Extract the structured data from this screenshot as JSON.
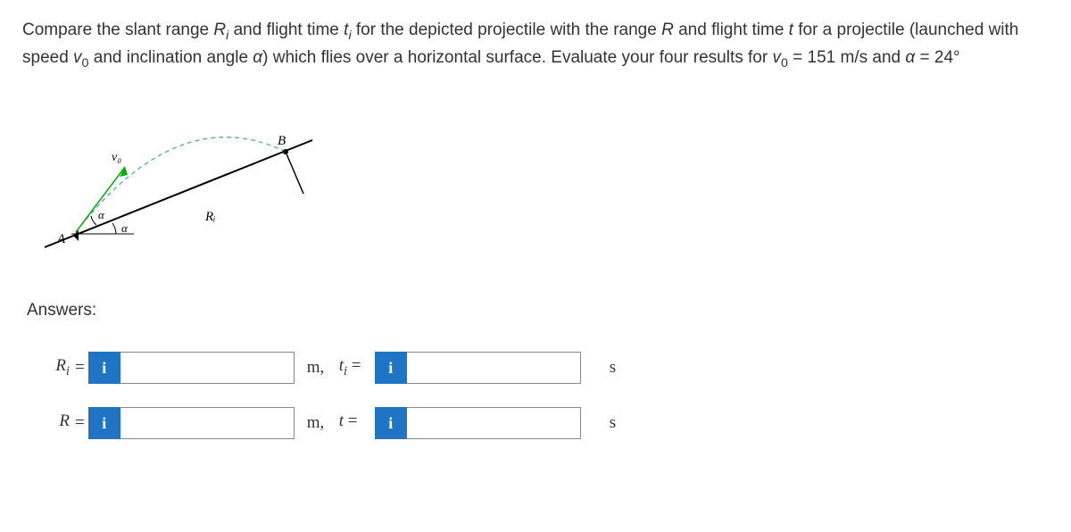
{
  "question": {
    "prefix": "Compare the slant range ",
    "var_Ri": "R",
    "sub_i": "i",
    "q_part2": " and flight time ",
    "var_ti": "t",
    "q_part3": " for the depicted projectile with the range ",
    "var_R": "R",
    "q_part4": " and flight time ",
    "var_t": "t",
    "q_part5": " for a projectile (launched with speed ",
    "var_v0": "v",
    "sub_0": "0",
    "q_part6": " and inclination angle ",
    "var_alpha": "α",
    "q_part7": ") which flies over a horizontal surface. Evaluate your four results for ",
    "v0_val": " = 151 m/s and ",
    "alpha_val": " = 24°"
  },
  "figure": {
    "A": "A",
    "B": "B",
    "v0": "v₀",
    "alpha1": "α",
    "alpha2": "α",
    "Ri": "Rᵢ"
  },
  "answers_heading": "Answers:",
  "rows": {
    "r1": {
      "label": "R",
      "sub": "i",
      "eq": "=",
      "info": "i",
      "unit": "m,",
      "tlabel": "t",
      "tsub": "i",
      "teq": "=",
      "tunit": "s"
    },
    "r2": {
      "label": "R",
      "sub": "",
      "eq": "=",
      "info": "i",
      "unit": "m,",
      "tlabel": "t",
      "tsub": "",
      "teq": "=",
      "tunit": "s"
    }
  }
}
